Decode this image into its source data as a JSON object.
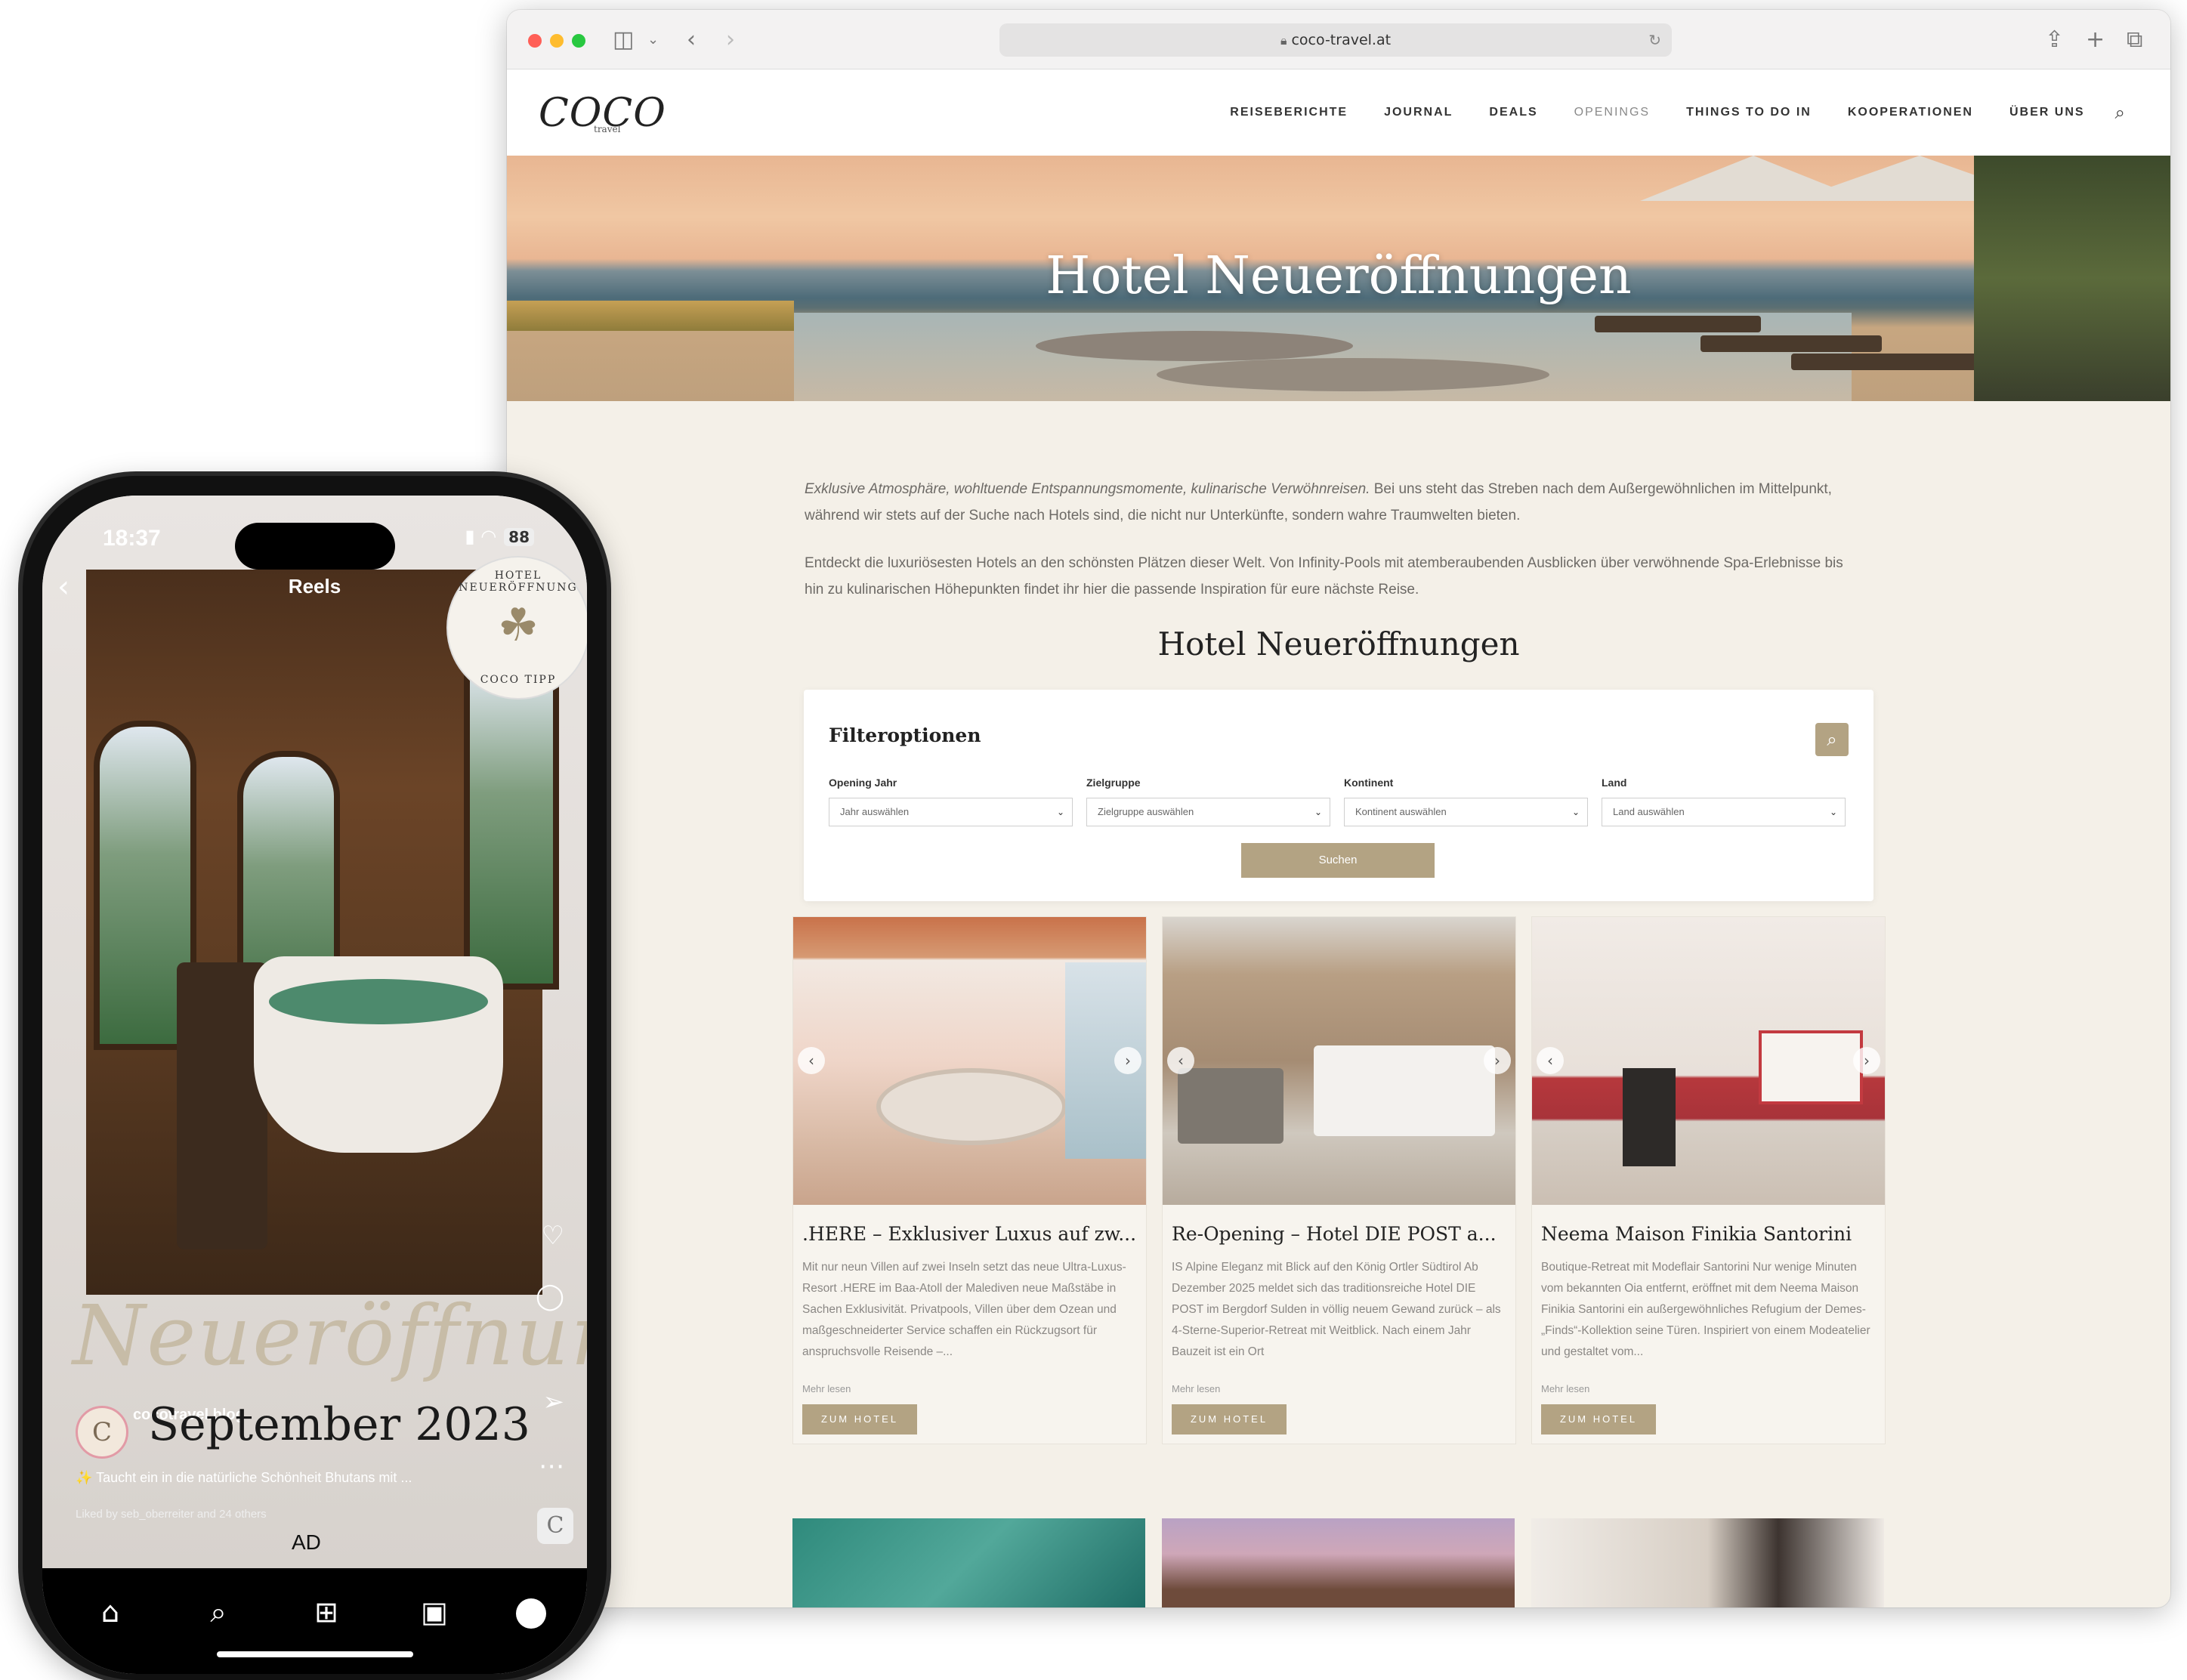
{
  "browser": {
    "url": "coco-travel.at"
  },
  "site": {
    "logo": "COCO",
    "logo_sub": "travel",
    "nav": [
      "REISEBERICHTE",
      "JOURNAL",
      "DEALS",
      "OPENINGS",
      "THINGS TO DO IN",
      "KOOPERATIONEN",
      "ÜBER UNS"
    ]
  },
  "hero": {
    "title": "Hotel Neueröffnungen"
  },
  "intro": {
    "p1_em": "Exklusive Atmosphäre, wohltuende Entspannungsmomente, kulinarische Verwöhnreisen.",
    "p1_rest": " Bei uns steht das Streben nach dem Außergewöhnlichen im Mittelpunkt, während wir stets auf der Suche nach Hotels sind, die nicht nur Unterkünfte, sondern wahre Traumwelten bieten.",
    "p2": "Entdeckt die luxuriösesten Hotels an den schönsten Plätzen dieser Welt. Von Infinity-Pools mit atemberaubenden Ausblicken über verwöhnende Spa-Erlebnisse bis hin zu kulinarischen Höhepunkten findet ihr hier die passende Inspiration für eure nächste Reise."
  },
  "section": {
    "title": "Hotel Neueröffnungen"
  },
  "filter": {
    "title": "Filteroptionen",
    "fields": [
      {
        "label": "Opening Jahr",
        "value": "Jahr auswählen"
      },
      {
        "label": "Zielgruppe",
        "value": "Zielgruppe auswählen"
      },
      {
        "label": "Kontinent",
        "value": "Kontinent auswählen"
      },
      {
        "label": "Land",
        "value": "Land auswählen"
      }
    ],
    "submit": "Suchen"
  },
  "cards": [
    {
      "title": ".HERE – Exklusiver Luxus auf zw...",
      "text": "Mit nur neun Villen auf zwei Inseln setzt das neue Ultra-Luxus-Resort .HERE im Baa-Atoll der Malediven neue Maßstäbe in Sachen Exklusivität. Privatpools, Villen über dem Ozean und maßgeschneiderter Service schaffen ein Rückzugsort für anspruchsvolle Reisende –...",
      "more": "Mehr lesen",
      "button": "ZUM HOTEL"
    },
    {
      "title": "Re-Opening – Hotel DIE POST a...",
      "text": "IS Alpine Eleganz mit Blick auf den König Ortler Südtirol Ab Dezember 2025 meldet sich das traditionsreiche Hotel DIE POST im Bergdorf Sulden in völlig neuem Gewand zurück – als 4-Sterne-Superior-Retreat mit Weitblick. Nach einem Jahr Bauzeit ist ein Ort",
      "more": "Mehr lesen",
      "button": "ZUM HOTEL"
    },
    {
      "title": "Neema Maison Finikia Santorini",
      "text": "Boutique-Retreat mit Modeflair Santorini Nur wenige Minuten vom bekannten Oia entfernt, eröffnet mit dem Neema Maison Finikia Santorini ein außergewöhnliches Refugium der Demes-„Finds“-Kollektion seine Türen. Inspiriert von einem Modeatelier und gestaltet vom...",
      "more": "Mehr lesen",
      "button": "ZUM HOTEL"
    }
  ],
  "phone": {
    "time": "18:37",
    "battery": "88",
    "reels_label": "Reels",
    "stamp_top": "HOTEL NEUERÖFFNUNG",
    "stamp_bottom": "COCO TIPP",
    "script_word": "Neueröffnung",
    "month": "September 2023",
    "username": "cocotravel.blog",
    "caption": "✨ Taucht ein in die natürliche Schönheit Bhutans mit ...",
    "liked": "Liked by seb_oberreiter and 24 others",
    "ad": "AD"
  }
}
